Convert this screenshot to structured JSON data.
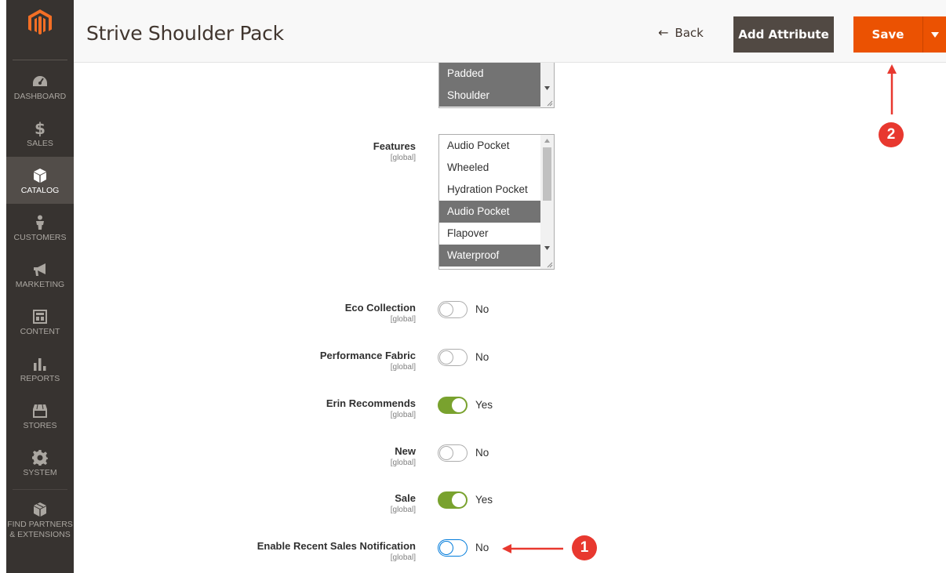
{
  "sidebar": {
    "logo": "magento-logo",
    "items": [
      {
        "label": "DASHBOARD",
        "icon": "dashboard-gauge-icon"
      },
      {
        "label": "SALES",
        "icon": "dollar-icon"
      },
      {
        "label": "CATALOG",
        "icon": "cube-icon",
        "active": true
      },
      {
        "label": "CUSTOMERS",
        "icon": "person-icon"
      },
      {
        "label": "MARKETING",
        "icon": "megaphone-icon"
      },
      {
        "label": "CONTENT",
        "icon": "layout-icon"
      },
      {
        "label": "REPORTS",
        "icon": "bar-chart-icon"
      },
      {
        "label": "STORES",
        "icon": "storefront-icon"
      },
      {
        "label": "SYSTEM",
        "icon": "gear-icon"
      },
      {
        "label": "FIND PARTNERS & EXTENSIONS",
        "icon": "puzzle-cube-icon"
      }
    ]
  },
  "header": {
    "title": "Strive Shoulder Pack",
    "back_label": "Back",
    "add_attribute_label": "Add Attribute",
    "save_label": "Save"
  },
  "strap_select": {
    "options": [
      "Padded",
      "Shoulder"
    ],
    "selected": [
      "Padded",
      "Shoulder"
    ]
  },
  "features": {
    "label": "Features",
    "scope": "[global]",
    "options": [
      "Audio Pocket",
      "Wheeled",
      "Hydration Pocket",
      "Audio Pocket",
      "Flapover",
      "Waterproof"
    ],
    "selected_index": [
      3,
      5
    ]
  },
  "toggles": [
    {
      "label": "Eco Collection",
      "scope": "[global]",
      "value": "No",
      "on": false
    },
    {
      "label": "Performance Fabric",
      "scope": "[global]",
      "value": "No",
      "on": false
    },
    {
      "label": "Erin Recommends",
      "scope": "[global]",
      "value": "Yes",
      "on": true
    },
    {
      "label": "New",
      "scope": "[global]",
      "value": "No",
      "on": false
    },
    {
      "label": "Sale",
      "scope": "[global]",
      "value": "Yes",
      "on": true
    },
    {
      "label": "Enable Recent Sales Notification",
      "scope": "[global]",
      "value": "No",
      "on": false
    }
  ],
  "annotations": {
    "badge_1": "1",
    "badge_2": "2"
  },
  "colors": {
    "sidebar_bg": "#373330",
    "accent_orange": "#eb5202",
    "toggle_on": "#79a22e",
    "annotation_red": "#e8382f"
  }
}
